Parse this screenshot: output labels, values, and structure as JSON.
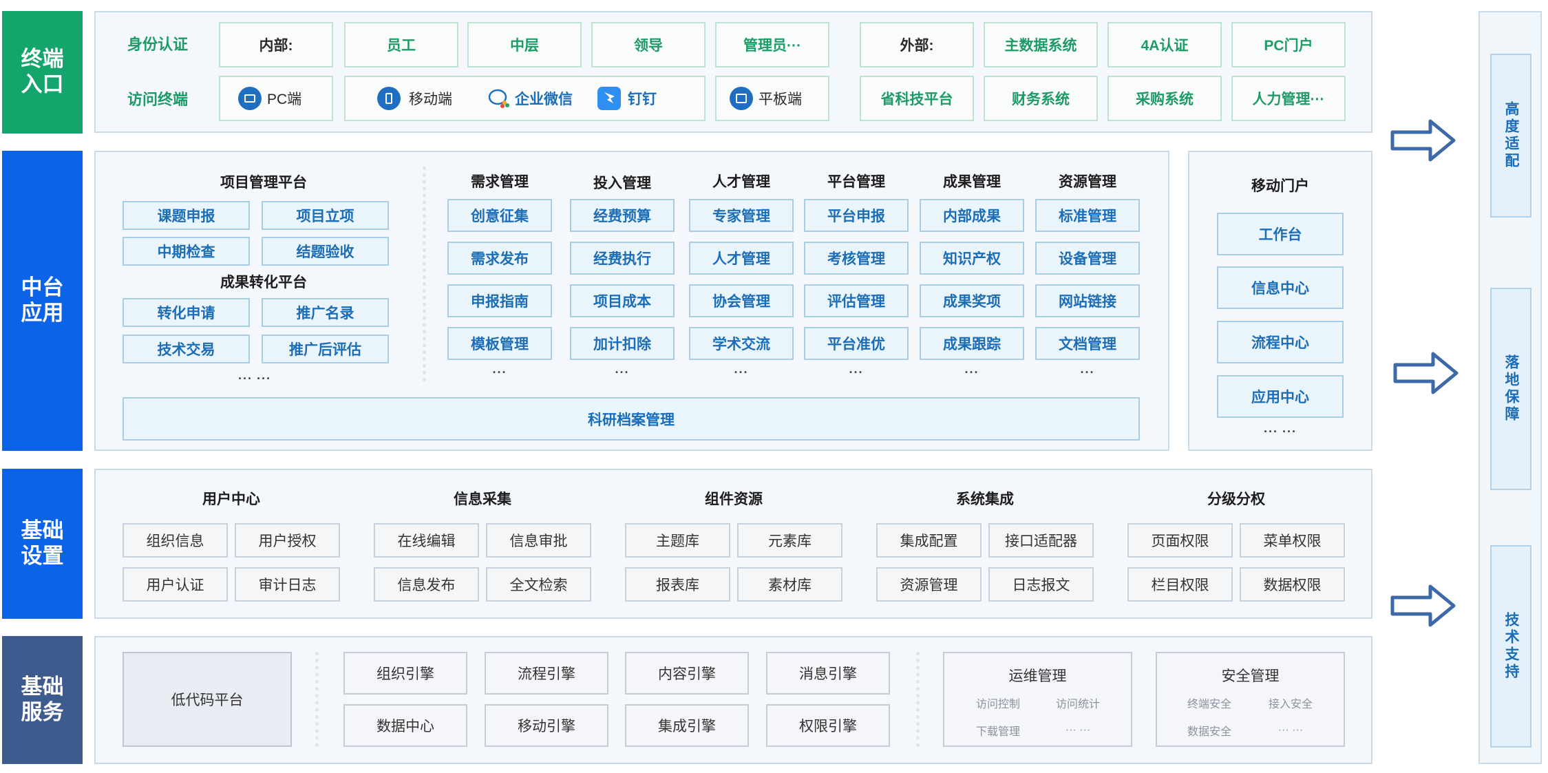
{
  "colors": {
    "layer1": "#14a56c",
    "layer2": "#0c63e8",
    "layer3": "#0c63e8",
    "layer4": "#3e5b8e",
    "accent_green": "#1d9a66",
    "accent_blue": "#1b6db7",
    "arrow": "#3d6aa6"
  },
  "layers": {
    "terminal": "终端\n入口",
    "middle": "中台\n应用",
    "settings": "基础\n设置",
    "service": "基础\n服务"
  },
  "terminal": {
    "identity_head": "身份认证",
    "access_head": "访问终端",
    "internal_label": "内部:",
    "internal_items": [
      "员工",
      "中层",
      "领导",
      "管理员···"
    ],
    "external_label": "外部:",
    "external_items": [
      "主数据系统",
      "4A认证",
      "PC门户"
    ],
    "pc": "PC端",
    "mobile": "移动端",
    "wecom": "企业微信",
    "dingtalk": "钉钉",
    "tablet": "平板端",
    "systems": [
      "省科技平台",
      "财务系统",
      "采购系统",
      "人力管理···"
    ]
  },
  "middle": {
    "project_platform": "项目管理平台",
    "project_items": [
      "课题申报",
      "项目立项",
      "中期检查",
      "结题验收"
    ],
    "transform_platform": "成果转化平台",
    "transform_items": [
      "转化申请",
      "推广名录",
      "技术交易",
      "推广后评估"
    ],
    "left_dots": "··· ···",
    "columns": [
      {
        "head": "需求管理",
        "items": [
          "创意征集",
          "需求发布",
          "申报指南",
          "模板管理"
        ]
      },
      {
        "head": "投入管理",
        "items": [
          "经费预算",
          "经费执行",
          "项目成本",
          "加计扣除"
        ]
      },
      {
        "head": "人才管理",
        "items": [
          "专家管理",
          "人才管理",
          "协会管理",
          "学术交流"
        ]
      },
      {
        "head": "平台管理",
        "items": [
          "平台申报",
          "考核管理",
          "评估管理",
          "平台准优"
        ]
      },
      {
        "head": "成果管理",
        "items": [
          "内部成果",
          "知识产权",
          "成果奖项",
          "成果跟踪"
        ]
      },
      {
        "head": "资源管理",
        "items": [
          "标准管理",
          "设备管理",
          "网站链接",
          "文档管理"
        ]
      }
    ],
    "col_dots": "···",
    "archive": "科研档案管理",
    "mobile_portal": "移动门户",
    "portal_items": [
      "工作台",
      "信息中心",
      "流程中心",
      "应用中心"
    ],
    "portal_dots": "··· ···"
  },
  "settings": {
    "groups": [
      {
        "head": "用户中心",
        "items": [
          "组织信息",
          "用户授权",
          "用户认证",
          "审计日志"
        ]
      },
      {
        "head": "信息采集",
        "items": [
          "在线编辑",
          "信息审批",
          "信息发布",
          "全文检索"
        ]
      },
      {
        "head": "组件资源",
        "items": [
          "主题库",
          "元素库",
          "报表库",
          "素材库"
        ]
      },
      {
        "head": "系统集成",
        "items": [
          "集成配置",
          "接口适配器",
          "资源管理",
          "日志报文"
        ]
      },
      {
        "head": "分级分权",
        "items": [
          "页面权限",
          "菜单权限",
          "栏目权限",
          "数据权限"
        ]
      }
    ]
  },
  "service": {
    "lowcode": "低代码平台",
    "engines": [
      "组织引擎",
      "流程引擎",
      "内容引擎",
      "消息引擎",
      "数据中心",
      "移动引擎",
      "集成引擎",
      "权限引擎"
    ],
    "ops": {
      "head": "运维管理",
      "items": [
        "访问控制",
        "访问统计",
        "下载管理",
        "··· ···"
      ]
    },
    "security": {
      "head": "安全管理",
      "items": [
        "终端安全",
        "接入安全",
        "数据安全",
        "··· ···"
      ]
    }
  },
  "right": [
    "高度适配",
    "落地保障",
    "技术支持"
  ]
}
